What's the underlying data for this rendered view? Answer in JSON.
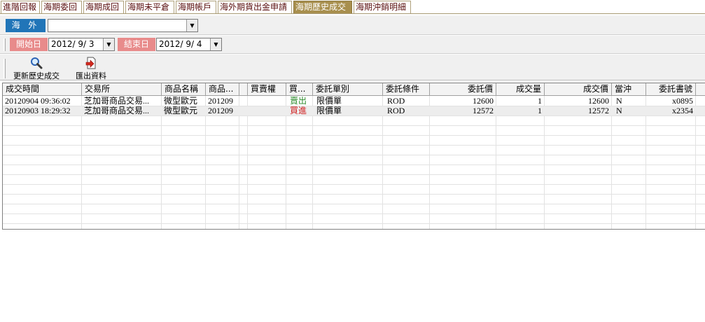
{
  "tabs": [
    {
      "label": "進階回報",
      "active": false
    },
    {
      "label": "海期委回",
      "active": false
    },
    {
      "label": "海期成回",
      "active": false
    },
    {
      "label": "海期未平倉",
      "active": false
    },
    {
      "label": "海期帳戶",
      "active": false
    },
    {
      "label": "海外期貨出金申請",
      "active": false
    },
    {
      "label": "海期歷史成交",
      "active": true
    },
    {
      "label": "海期沖銷明細",
      "active": false
    }
  ],
  "market": {
    "label": "海 外",
    "selected": ""
  },
  "dates": {
    "start_label": "開始日",
    "start_value": "2012/ 9/ 3",
    "end_label": "結束日",
    "end_value": "2012/ 9/ 4"
  },
  "toolbar": {
    "refresh_label": "更新歷史成交",
    "export_label": "匯出資料"
  },
  "table": {
    "columns": [
      "成交時間",
      "交易所",
      "商品名稱",
      "商品...",
      "",
      "買賣權",
      "買...",
      "委託單別",
      "委託條件",
      "委託價",
      "成交量",
      "成交價",
      "當沖",
      "委託書號"
    ],
    "rows": [
      [
        "20120904 09:36:02",
        "芝加哥商品交易...",
        "微型歐元",
        "201209",
        "",
        "",
        "賣出",
        "限價單",
        "ROD",
        "12600",
        "1",
        "12600",
        "N",
        "x0895"
      ],
      [
        "20120903 18:29:32",
        "芝加哥商品交易...",
        "微型歐元",
        "201209",
        "",
        "",
        "買進",
        "限價單",
        "ROD",
        "12572",
        "1",
        "12572",
        "N",
        "x2354"
      ]
    ]
  },
  "colors": {
    "active_tab": "#a88f4e",
    "market_label": "#2175b8",
    "date_label": "#e88b8b",
    "sell": "#2a8a2a",
    "buy": "#d02020"
  }
}
